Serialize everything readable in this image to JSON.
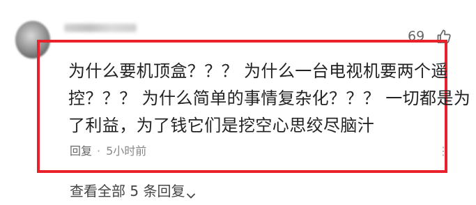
{
  "comment": {
    "like_count": "69",
    "text_lines": [
      "为什么要机顶盒？？？ 为什么一台电视机要两个遥",
      "控？？？ 为什么简单的事情复杂化？？？ 一切都是为",
      "了利益，为了钱它们是挖空心思绞尽脑汁"
    ],
    "reply_label": "回复",
    "separator": "·",
    "time_ago": "5小时前",
    "more_symbol": "⋮"
  },
  "replies": {
    "view_label": "查看全部 5 条回复"
  },
  "colors": {
    "highlight_border": "#e8212b"
  },
  "icons": {
    "like": "thumbs-up-icon",
    "more": "more-icon",
    "expand": "chevron-down-icon"
  }
}
